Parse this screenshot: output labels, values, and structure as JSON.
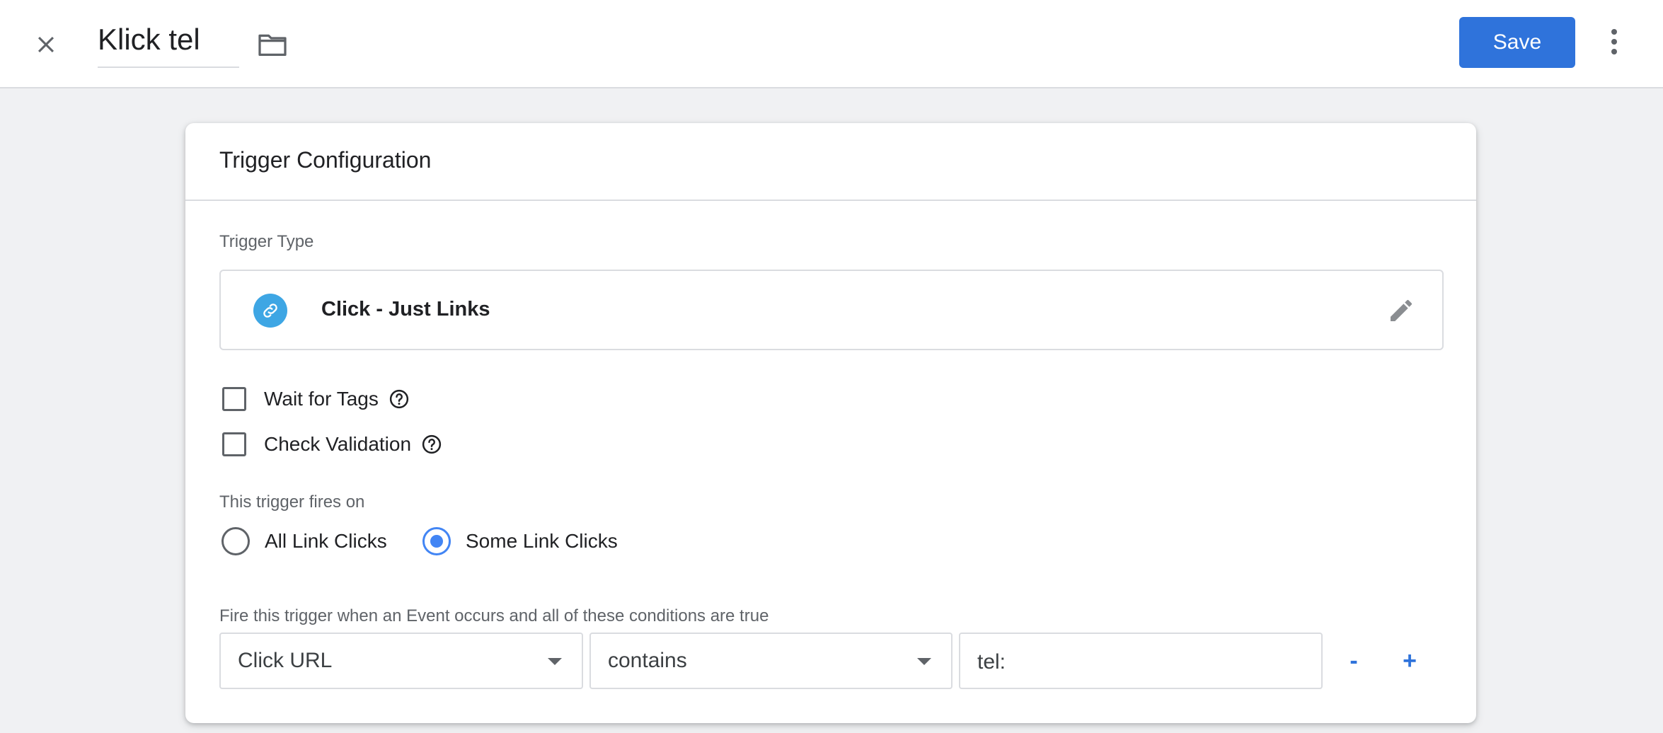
{
  "header": {
    "title": "Klick tel",
    "save_label": "Save",
    "icons": [
      "close-icon",
      "folder-icon",
      "more-vert-icon"
    ]
  },
  "card": {
    "title": "Trigger Configuration",
    "trigger_type_label": "Trigger Type",
    "trigger_type": {
      "name": "Click - Just Links",
      "icon": "link-icon",
      "icon_color": "#3ea6e4"
    },
    "checkboxes": [
      {
        "label": "Wait for Tags",
        "checked": false
      },
      {
        "label": "Check Validation",
        "checked": false
      }
    ],
    "fires_on_label": "This trigger fires on",
    "fires_on_options": [
      {
        "label": "All Link Clicks",
        "selected": false
      },
      {
        "label": "Some Link Clicks",
        "selected": true
      }
    ],
    "conditions_label": "Fire this trigger when an Event occurs and all of these conditions are true",
    "condition": {
      "variable": "Click URL",
      "operator": "contains",
      "value": "tel:",
      "remove_label": "-",
      "add_label": "+"
    }
  },
  "colors": {
    "accent": "#2f73db",
    "radio_selected": "#4285f4",
    "background": "#f0f1f3"
  }
}
